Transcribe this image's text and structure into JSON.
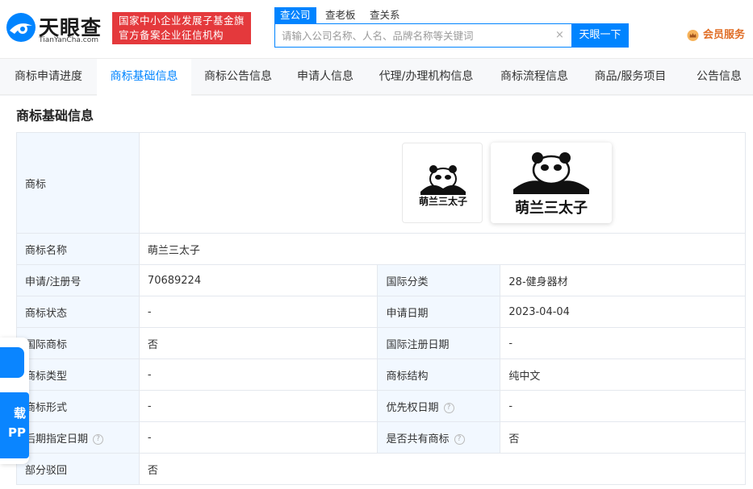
{
  "brand": {
    "name": "天眼查",
    "domain": "TianYanCha.com"
  },
  "badge": {
    "line1": "国家中小企业发展子基金旗下",
    "line2": "官方备案企业征信机构"
  },
  "search": {
    "tabs": [
      "查公司",
      "查老板",
      "查关系"
    ],
    "placeholder": "请输入公司名称、人名、品牌名称等关键词",
    "button": "天眼一下"
  },
  "vip": {
    "label": "会员服务"
  },
  "tabs": [
    "商标申请进度",
    "商标基础信息",
    "商标公告信息",
    "申请人信息",
    "代理/办理机构信息",
    "商标流程信息",
    "商品/服务项目",
    "公告信息"
  ],
  "active_tab": "商标基础信息",
  "section_title": "商标基础信息",
  "trademark": {
    "label": "商标",
    "image_text": "萌兰三太子"
  },
  "rows": {
    "name": {
      "label": "商标名称",
      "value": "萌兰三太子"
    },
    "reg_no": {
      "label": "申请/注册号",
      "value": "70689224"
    },
    "intl_class": {
      "label": "国际分类",
      "value": "28-健身器材"
    },
    "status": {
      "label": "商标状态",
      "value": "-"
    },
    "apply_date": {
      "label": "申请日期",
      "value": "2023-04-04"
    },
    "intl_mark": {
      "label": "国际商标",
      "value": "否"
    },
    "intl_reg_date": {
      "label": "国际注册日期",
      "value": "-"
    },
    "type": {
      "label": "商标类型",
      "value": "-"
    },
    "structure": {
      "label": "商标结构",
      "value": "纯中文"
    },
    "form": {
      "label": "商标形式",
      "value": "-"
    },
    "priority_date": {
      "label": "优先权日期",
      "value": "-"
    },
    "late_date": {
      "label": "后期指定日期",
      "value": "-"
    },
    "shared": {
      "label": "是否共有商标",
      "value": "否"
    },
    "partial": {
      "label": "部分驳回",
      "value": "否"
    }
  },
  "side_app": {
    "line1": "载",
    "line2": "PP"
  },
  "colors": {
    "primary": "#0084ff",
    "badge_red": "#e4393c",
    "vip_orange": "#e06d25",
    "label_bg": "#f2f8ff"
  }
}
